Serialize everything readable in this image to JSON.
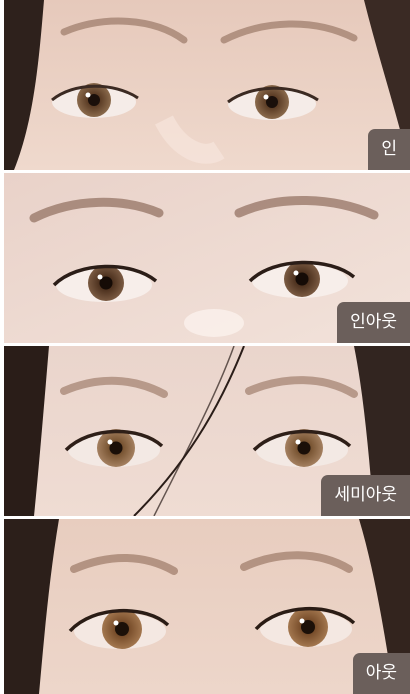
{
  "photos": [
    {
      "label": "인"
    },
    {
      "label": "인아웃"
    },
    {
      "label": "세미아웃"
    },
    {
      "label": "아웃"
    }
  ],
  "colors": {
    "label_background": "#6b5f5b",
    "label_text": "#ffffff",
    "iris_brown": "#6e4a2e"
  }
}
